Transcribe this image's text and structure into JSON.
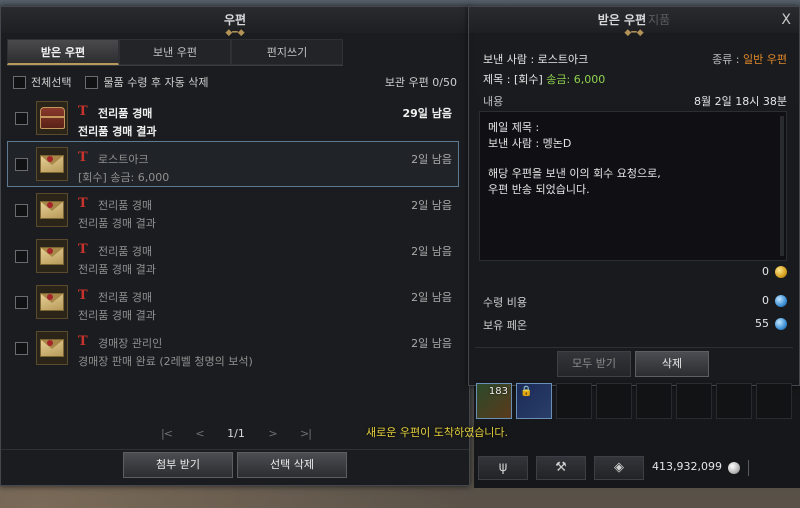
{
  "mailbox": {
    "title": "우편",
    "tabs": [
      {
        "label": "받은 우편",
        "active": true
      },
      {
        "label": "보낸 우편",
        "active": false
      },
      {
        "label": "편지쓰기",
        "active": false
      }
    ],
    "select_all_label": "전체선택",
    "auto_delete_label": "물품 수령 후 자동 삭제",
    "storage_label": "보관 우편 0/50",
    "mails": [
      {
        "sender": "전리품 경매",
        "subject": "전리품 경매 결과",
        "remaining": "29일 남음",
        "thumb": "chest-icon"
      },
      {
        "sender": "로스트아크",
        "subject": "[회수] 송금: 6,000",
        "remaining": "2일 남음",
        "thumb": "envelope-icon"
      },
      {
        "sender": "전리품 경매",
        "subject": "전리품 경매 결과",
        "remaining": "2일 남음",
        "thumb": "envelope-icon"
      },
      {
        "sender": "전리품 경매",
        "subject": "전리품 경매 결과",
        "remaining": "2일 남음",
        "thumb": "envelope-icon"
      },
      {
        "sender": "전리품 경매",
        "subject": "전리품 경매 결과",
        "remaining": "2일 남음",
        "thumb": "envelope-icon"
      },
      {
        "sender": "경매장 관리인",
        "subject": "경매장 판매 완료 (2레벨 청명의 보석)",
        "remaining": "2일 남음",
        "thumb": "envelope-icon"
      }
    ],
    "pager": {
      "first": "|<",
      "prev": "<",
      "page": "1/1",
      "next": ">",
      "last": ">|"
    },
    "attach_button": "첨부 받기",
    "delete_selected_button": "선택 삭제",
    "new_mail_notice": "새로운 우편이 도착하였습니다."
  },
  "detail": {
    "title": "받은 우편",
    "title_faded": "지품",
    "close": "X",
    "sender_label": "보낸 사람 : 로스트아크",
    "type_label": "종류 :",
    "type_value": "일반 우편",
    "subject_label": "제목 : [회수]",
    "subject_amount": "송금: 6,000",
    "content_label": "내용",
    "date": "8월 2일 18시 38분",
    "message": {
      "line1": "메일 제목 :",
      "line2": "보낸 사람 : 멩논D",
      "line3": "해당 우편을 보낸 이의 회수 요청으로,",
      "line4": "우편 반송 되었습니다."
    },
    "attached_gold": "0",
    "receive_cost_label": "수령 비용",
    "receive_cost": "0",
    "owned_pheon_label": "보유 페온",
    "owned_pheon": "55",
    "receive_all_button": "모두 받기",
    "delete_button": "삭제"
  },
  "inventory": {
    "slot1_count": "183",
    "money": "413,932,099"
  },
  "colors": {
    "accent_gold": "#b89a5a",
    "type_orange": "#e28a2a",
    "amount_green": "#8fd14f",
    "notice_yellow": "#e4d03c",
    "sender_red": "#c8332c"
  }
}
